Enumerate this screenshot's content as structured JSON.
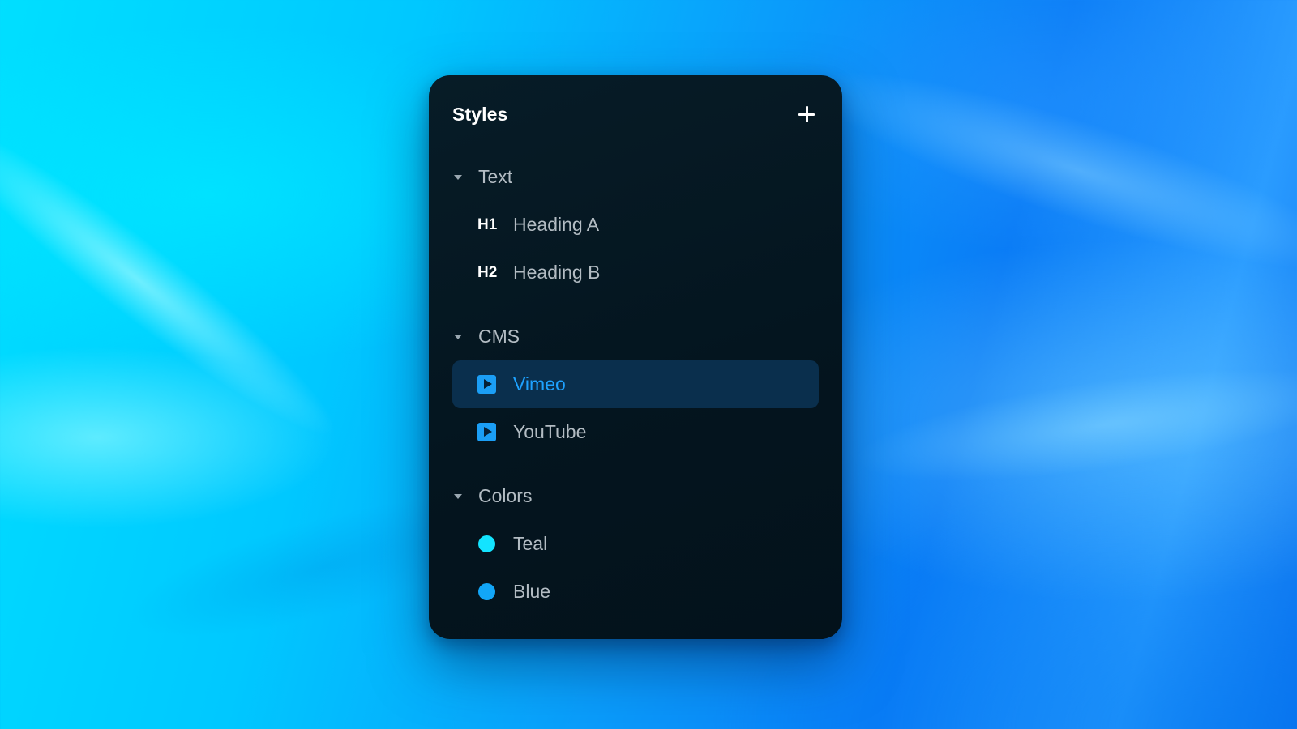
{
  "panel": {
    "title": "Styles",
    "add_icon": "plus-icon"
  },
  "sections": {
    "text": {
      "label": "Text",
      "items": [
        {
          "badge": "H1",
          "label": "Heading A"
        },
        {
          "badge": "H2",
          "label": "Heading B"
        }
      ]
    },
    "cms": {
      "label": "CMS",
      "items": [
        {
          "icon": "video-play-icon",
          "label": "Vimeo",
          "selected": true
        },
        {
          "icon": "video-play-icon",
          "label": "YouTube",
          "selected": false
        }
      ]
    },
    "colors": {
      "label": "Colors",
      "items": [
        {
          "label": "Teal",
          "color": "#13e4ff"
        },
        {
          "label": "Blue",
          "color": "#12a6f7"
        }
      ]
    }
  },
  "theme": {
    "accent": "#1ea2ff",
    "selected_bg": "#0a2f4d",
    "panel_bg": "#04151f"
  }
}
